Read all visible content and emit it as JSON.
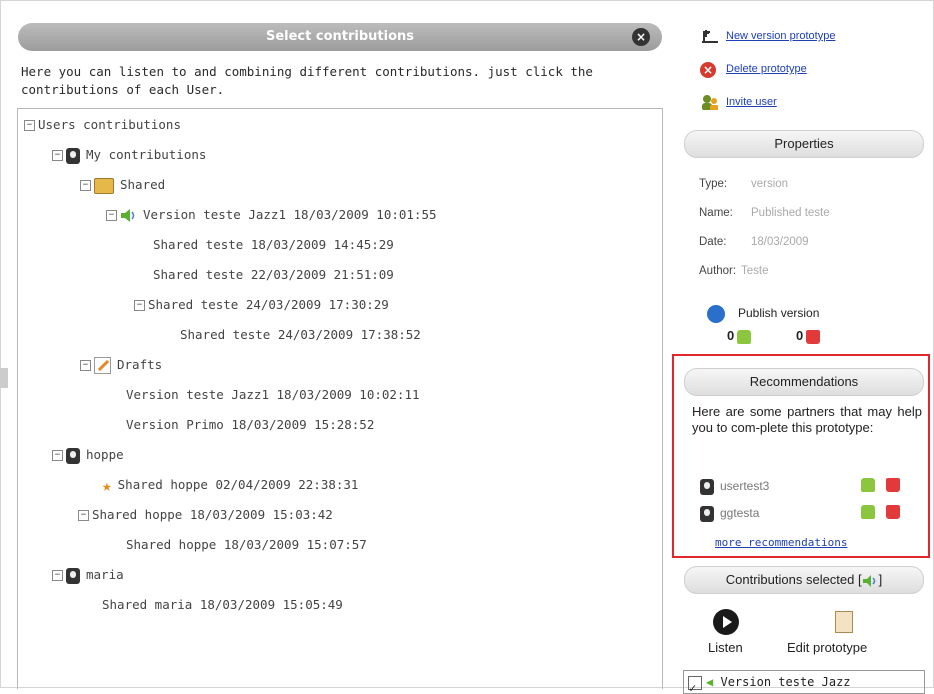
{
  "header": {
    "title": "Select contributions"
  },
  "intro": "Here you can listen to and combining different contributions. just click the contributions of each User.",
  "tree": {
    "root": "Users contributions",
    "my_contributions": "My contributions",
    "shared": "Shared",
    "version_jazz": "Version teste Jazz1  18/03/2009  10:01:55",
    "shared1": "Shared teste  18/03/2009  14:45:29",
    "shared2": "Shared teste  22/03/2009  21:51:09",
    "shared3": "Shared teste  24/03/2009  17:30:29",
    "shared4": "Shared teste  24/03/2009  17:38:52",
    "drafts": "Drafts",
    "draft1": "Version teste Jazz1  18/03/2009  10:02:11",
    "draft2": "Version Primo  18/03/2009  15:28:52",
    "hoppe": "hoppe",
    "hoppe1": "Shared hoppe  02/04/2009  22:38:31",
    "hoppe2": "Shared hoppe  18/03/2009  15:03:42",
    "hoppe3": "Shared hoppe  18/03/2009  15:07:57",
    "maria": "maria",
    "maria1": "Shared maria  18/03/2009  15:05:49"
  },
  "actions": {
    "new_version": "New version prototype",
    "delete": "Delete prototype",
    "invite": "Invite user"
  },
  "properties": {
    "title": "Properties",
    "type_label": "Type:",
    "type_value": "version",
    "name_label": "Name:",
    "name_value": "Published teste",
    "date_label": "Date:",
    "date_value": "18/03/2009",
    "author_label": "Author:",
    "author_value": "Teste",
    "publish": "Publish version",
    "votes_up": "0",
    "votes_down": "0"
  },
  "recommendations": {
    "title": "Recommendations",
    "text": "Here are some partners that may help you to com-plete this prototype:",
    "partners": [
      "usertest3",
      "ggtesta"
    ],
    "more": "more recommendations"
  },
  "selected": {
    "title": "Contributions selected [",
    "title_end": "]",
    "listen": "Listen",
    "edit": "Edit prototype",
    "item": "Version teste Jazz"
  },
  "colors": {
    "accent_red": "#e3262b",
    "link_blue": "#1f3fb5",
    "thumb_up": "#8cc63f",
    "thumb_down": "#e23a3a"
  }
}
